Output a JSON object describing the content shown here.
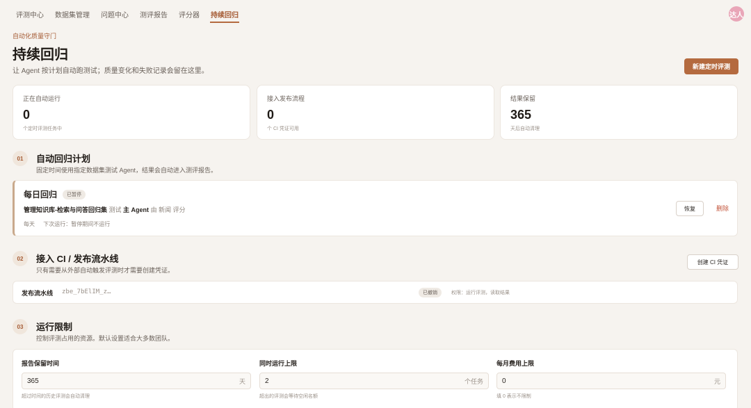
{
  "nav": {
    "tabs": [
      {
        "label": "评测中心"
      },
      {
        "label": "数据集管理"
      },
      {
        "label": "问题中心"
      },
      {
        "label": "测评报告"
      },
      {
        "label": "评分器"
      },
      {
        "label": "持续回归"
      }
    ],
    "active_index": 5,
    "avatar_text": "达人"
  },
  "header": {
    "eyebrow": "自动化质量守门",
    "title": "持续回归",
    "description": "让 Agent 按计划自动跑测试；质量变化和失败记录会留在这里。",
    "new_button": "新建定时评测"
  },
  "stats": [
    {
      "label": "正在自动运行",
      "value": "0",
      "sub": "个定时评测任务中"
    },
    {
      "label": "接入发布流程",
      "value": "0",
      "sub": "个 CI 凭证可用"
    },
    {
      "label": "结果保留",
      "value": "365",
      "sub": "天后自动清理"
    }
  ],
  "sections": {
    "schedule": {
      "num": "01",
      "title": "自动回归计划",
      "desc": "固定时间使用指定数据集测试 Agent，结果会自动进入测评报告。"
    },
    "ci": {
      "num": "02",
      "title": "接入 CI / 发布流水线",
      "desc": "只有需要从外部自动触发评测时才需要创建凭证。",
      "create_button": "创建 CI 凭证"
    },
    "limits": {
      "num": "03",
      "title": "运行限制",
      "desc": "控制评测占用的资源。默认设置适合大多数团队。"
    }
  },
  "schedule_item": {
    "name": "每日回归",
    "status": "已暂停",
    "dataset": "管理知识库-检索与问答回归集",
    "test_word": "测试",
    "agent_label": "主 Agent",
    "by_word": "由",
    "grader": "新闻 评分",
    "frequency": "每天",
    "next_run": "下次运行：暂停期间不运行",
    "resume_button": "恢复",
    "delete_button": "删除"
  },
  "pipeline": {
    "label": "发布流水线",
    "token": "zbe_7bElIM_z…",
    "status": "已撤销",
    "scope": "权限：运行评测，读取结果"
  },
  "limits": [
    {
      "label": "报告保留时间",
      "value": "365",
      "unit": "天",
      "hint": "超过时间的历史评测会自动清理"
    },
    {
      "label": "同时运行上限",
      "value": "2",
      "unit": "个任务",
      "hint": "超出的评测会等待空闲名额"
    },
    {
      "label": "每月费用上限",
      "value": "0",
      "unit": "元",
      "hint": "填 0 表示不限制"
    }
  ],
  "colors": {
    "accent": "#b46a3f",
    "danger": "#c4563d",
    "background": "#f6f3ef"
  }
}
